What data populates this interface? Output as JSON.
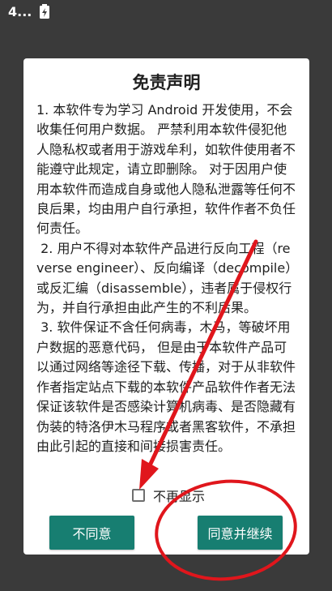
{
  "status_bar": {
    "time": "4...",
    "icon": "battery-charging-icon"
  },
  "dialog": {
    "title": "免责声明",
    "body": "1. 本软件专为学习 Android 开发使用，不会收集任何用户数据。 严禁利用本软件侵犯他人隐私权或者用于游戏牟利，如软件使用者不能遵守此规定，请立即删除。 对于因用户使用本软件而造成自身或他人隐私泄露等任何不良后果，均由用户自行承担，软件作者不负任何责任。\n 2. 用户不得对本软件产品进行反向工程（reverse engineer）、反向编译（decompile）或反汇编（disassemble），违者属于侵权行为，并自行承担由此产生的不利后果。\n 3. 软件保证不含任何病毒，木马，等破坏用户数据的恶意代码， 但是由于本软件产品可以通过网络等途径下载、传播，对于从非软件作者指定站点下载的本软件产品软件作者无法保证该软件是否感染计算机病毒、是否隐藏有伪装的特洛伊木马程序或者黑客软件，不承担由此引起的直接和间接损害责任。",
    "checkbox_label": "不再显示",
    "disagree_label": "不同意",
    "agree_label": "同意并继续"
  },
  "annotation_color": "#e0161c"
}
